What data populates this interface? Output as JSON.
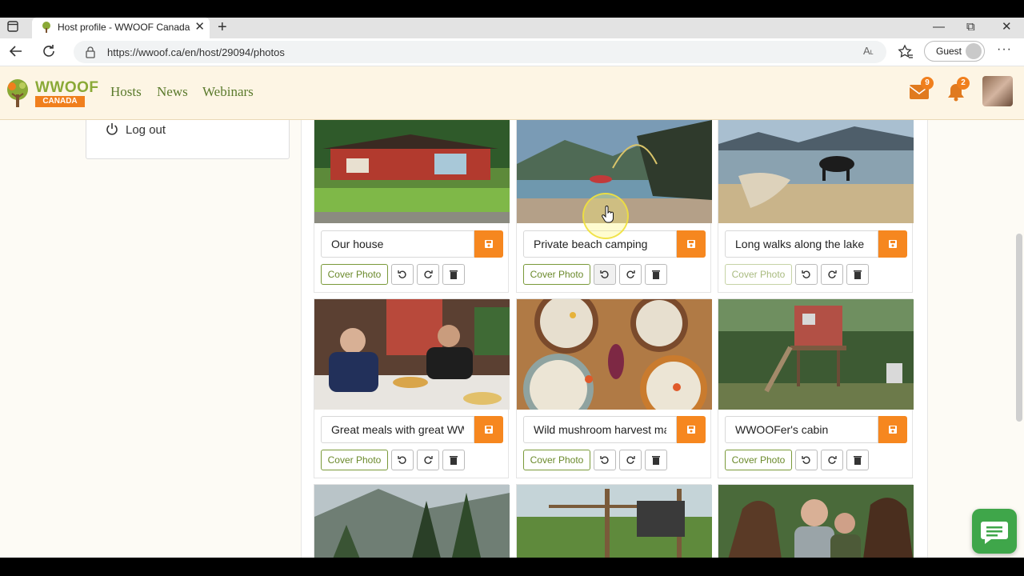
{
  "browser": {
    "tab_title": "Host profile - WWOOF Canada",
    "new_tab": "+",
    "url": "https://wwoof.ca/en/host/29094/photos",
    "read_aloud": "A˪",
    "profile_label": "Guest",
    "more": "···",
    "close_tab": "✕",
    "minimize": "—",
    "restore": "⧉",
    "close_window": "✕"
  },
  "site": {
    "logo_text": "WWOOF",
    "logo_sub": "CANADA",
    "nav": [
      "Hosts",
      "News",
      "Webinars"
    ],
    "messages_count": "9",
    "notifications_count": "2",
    "accent_color": "#f6871f",
    "brand_green": "#6b8a2c"
  },
  "sidebar": {
    "logout_label": "Log out"
  },
  "photos": [
    {
      "caption": "Our house",
      "cover_label": "Cover Photo"
    },
    {
      "caption": "Private beach camping",
      "cover_label": "Cover Photo"
    },
    {
      "caption": "Long walks along the lake",
      "cover_label": "Cover Photo"
    },
    {
      "caption": "Great meals with great WWOOFers",
      "cover_label": "Cover Photo"
    },
    {
      "caption": "Wild mushroom harvest made",
      "cover_label": "Cover Photo"
    },
    {
      "caption": "WWOOFer's cabin",
      "cover_label": "Cover Photo"
    }
  ]
}
